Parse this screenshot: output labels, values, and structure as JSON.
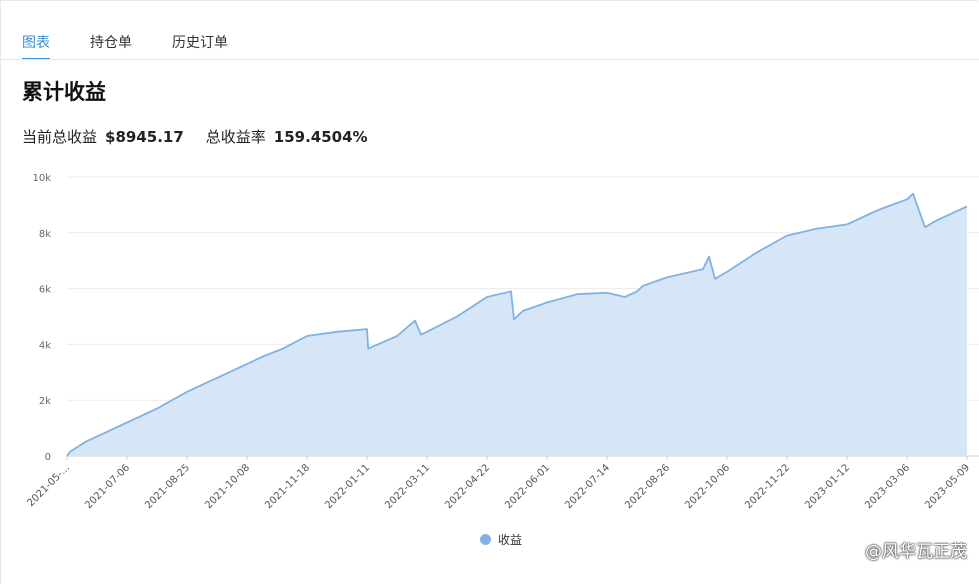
{
  "tabs": [
    {
      "label": "图表",
      "active": true
    },
    {
      "label": "持仓单",
      "active": false
    },
    {
      "label": "历史订单",
      "active": false
    }
  ],
  "title": "累计收益",
  "stats": {
    "current_label": "当前总收益",
    "current_value": "$8945.17",
    "rate_label": "总收益率",
    "rate_value": "159.4504%"
  },
  "watermark": "@风华瓦正茂",
  "colors": {
    "accent": "#3a8fd6",
    "area_fill": "#d6e6f7",
    "line": "#7fb2e5"
  },
  "chart_data": {
    "type": "area",
    "xlabel": "",
    "ylabel": "",
    "ylim": [
      0,
      10000
    ],
    "y_ticks": [
      0,
      2000,
      4000,
      6000,
      8000,
      10000
    ],
    "y_tick_labels": [
      "0",
      "2k",
      "4k",
      "6k",
      "8k",
      "10k"
    ],
    "x_tick_labels": [
      "2021-05-...",
      "2021-07-06",
      "2021-08-25",
      "2021-10-08",
      "2021-11-18",
      "2022-01-11",
      "2022-03-11",
      "2022-04-22",
      "2022-06-01",
      "2022-07-14",
      "2022-08-26",
      "2022-10-06",
      "2022-11-22",
      "2023-01-12",
      "2023-03-06",
      "2023-05-09"
    ],
    "grid": true,
    "legend": "bottom-center",
    "series": [
      {
        "name": "收益",
        "x": [
          0,
          0.05,
          0.3,
          0.6,
          1.0,
          1.5,
          2.0,
          2.5,
          3.0,
          3.3,
          3.6,
          4.0,
          4.5,
          5.0,
          5.02,
          5.5,
          5.8,
          5.9,
          6.0,
          6.5,
          7.0,
          7.4,
          7.45,
          7.6,
          8.0,
          8.5,
          9.0,
          9.3,
          9.5,
          9.6,
          10.0,
          10.6,
          10.7,
          10.8,
          11.0,
          11.5,
          12.0,
          12.5,
          13.0,
          13.5,
          14.0,
          14.1,
          14.3,
          14.5,
          15.0
        ],
        "values": [
          0,
          150,
          500,
          800,
          1200,
          1700,
          2300,
          2800,
          3300,
          3600,
          3850,
          4300,
          4450,
          4550,
          3850,
          4300,
          4850,
          4350,
          4450,
          5000,
          5700,
          5900,
          4900,
          5200,
          5500,
          5800,
          5850,
          5700,
          5900,
          6100,
          6400,
          6700,
          7150,
          6350,
          6600,
          7300,
          7900,
          8150,
          8300,
          8800,
          9200,
          9400,
          8200,
          8450,
          8945
        ]
      }
    ]
  }
}
